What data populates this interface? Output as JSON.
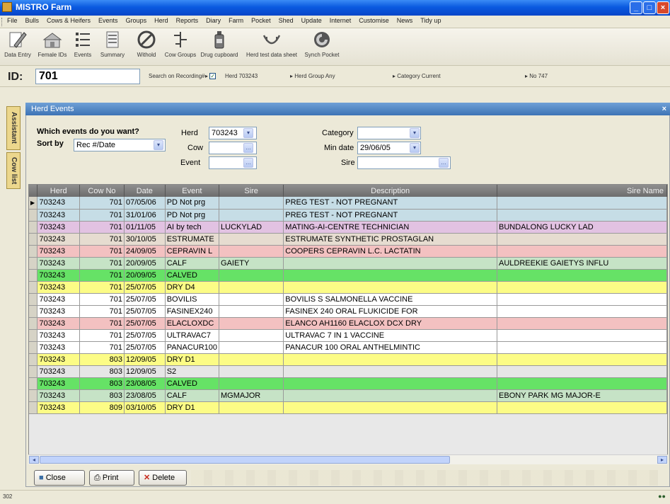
{
  "window": {
    "title": "MISTRO Farm"
  },
  "menu": [
    "File",
    "Bulls",
    "Cows & Heifers",
    "Events",
    "Groups",
    "Herd",
    "Reports",
    "Diary",
    "Farm",
    "Pocket",
    "Shed",
    "Update",
    "Internet",
    "Customise",
    "News",
    "Tidy up"
  ],
  "toolbar": [
    {
      "label": "Data Entry",
      "icon": "pencil-icon"
    },
    {
      "label": "Female IDs",
      "icon": "barn-icon"
    },
    {
      "label": "Events",
      "icon": "list-icon"
    },
    {
      "label": "Summary",
      "icon": "document-icon"
    },
    {
      "label": "Withold",
      "icon": "no-sign-icon"
    },
    {
      "label": "Cow Groups",
      "icon": "cow-groups-icon"
    },
    {
      "label": "Drug cupboard",
      "icon": "bottle-icon"
    },
    {
      "label": "Herd test data sheet",
      "icon": "udder-icon"
    },
    {
      "label": "Synch Pocket",
      "icon": "sync-icon"
    }
  ],
  "idbar": {
    "id_label": "ID:",
    "id_value": "701",
    "search_on": "Search on  Recording#",
    "herd_filter": "Herd  703243",
    "herd_group": "Herd Group  Any",
    "category": "Category  Current",
    "no": "No  747"
  },
  "side_tabs": [
    "Assistant",
    "Cow list"
  ],
  "panel": {
    "title": "Herd Events"
  },
  "criteria": {
    "question": "Which events do you want?",
    "sort_label": "Sort by",
    "sort_value": "Rec #/Date",
    "herd_label": "Herd",
    "herd_value": "703243",
    "cow_label": "Cow",
    "cow_value": "",
    "event_label": "Event",
    "event_value": "",
    "category_label": "Category",
    "category_value": "",
    "min_date_label": "Min date",
    "min_date_value": "29/06/05",
    "sire_label": "Sire",
    "sire_value": ""
  },
  "table": {
    "columns": [
      "Herd",
      "Cow No",
      "Date",
      "Event",
      "Sire",
      "Description",
      "Sire Name"
    ],
    "rows": [
      {
        "herd": "703243",
        "cow": "701",
        "date": "07/05/06",
        "event": "PD Not prg",
        "sire": "",
        "desc": "PREG TEST - NOT PREGNANT",
        "sire_name": "",
        "color": "#c6dde6"
      },
      {
        "herd": "703243",
        "cow": "701",
        "date": "31/01/06",
        "event": "PD Not prg",
        "sire": "",
        "desc": "PREG TEST - NOT PREGNANT",
        "sire_name": "",
        "color": "#c6dde6"
      },
      {
        "herd": "703243",
        "cow": "701",
        "date": "01/11/05",
        "event": "AI by tech",
        "sire": "LUCKYLAD",
        "desc": "MATING-AI-CENTRE TECHNICIAN",
        "sire_name": "BUNDALONG LUCKY LAD",
        "color": "#e2c2e2"
      },
      {
        "herd": "703243",
        "cow": "701",
        "date": "30/10/05",
        "event": "ESTRUMATE",
        "sire": "",
        "desc": "ESTRUMATE SYNTHETIC PROSTAGLAN",
        "sire_name": "",
        "color": "#e6dcd0"
      },
      {
        "herd": "703243",
        "cow": "701",
        "date": "24/09/05",
        "event": "CEPRAVIN L",
        "sire": "",
        "desc": "COOPERS CEPRAVIN L.C. LACTATIN",
        "sire_name": "",
        "color": "#f3c1c1"
      },
      {
        "herd": "703243",
        "cow": "701",
        "date": "20/09/05",
        "event": "CALF",
        "sire": "GAIETY",
        "desc": "",
        "sire_name": "AULDREEKIE GAIETYS INFLU",
        "color": "#c6e3c6"
      },
      {
        "herd": "703243",
        "cow": "701",
        "date": "20/09/05",
        "event": "CALVED",
        "sire": "",
        "desc": "",
        "sire_name": "",
        "color": "#66e266"
      },
      {
        "herd": "703243",
        "cow": "701",
        "date": "25/07/05",
        "event": "DRY D4",
        "sire": "",
        "desc": "",
        "sire_name": "",
        "color": "#fcfc86"
      },
      {
        "herd": "703243",
        "cow": "701",
        "date": "25/07/05",
        "event": "BOVILIS",
        "sire": "",
        "desc": "BOVILIS S SALMONELLA VACCINE",
        "sire_name": "",
        "color": "#ffffff"
      },
      {
        "herd": "703243",
        "cow": "701",
        "date": "25/07/05",
        "event": "FASINEX240",
        "sire": "",
        "desc": "FASINEX 240 ORAL FLUKICIDE FOR",
        "sire_name": "",
        "color": "#ffffff"
      },
      {
        "herd": "703243",
        "cow": "701",
        "date": "25/07/05",
        "event": "ELACLOXDC",
        "sire": "",
        "desc": "ELANCO AH1160 ELACLOX DCX DRY",
        "sire_name": "",
        "color": "#f3c1c1"
      },
      {
        "herd": "703243",
        "cow": "701",
        "date": "25/07/05",
        "event": "ULTRAVAC7",
        "sire": "",
        "desc": "ULTRAVAC 7 IN 1 VACCINE",
        "sire_name": "",
        "color": "#ffffff"
      },
      {
        "herd": "703243",
        "cow": "701",
        "date": "25/07/05",
        "event": "PANACUR100",
        "sire": "",
        "desc": "PANACUR 100 ORAL ANTHELMINTIC",
        "sire_name": "",
        "color": "#ffffff"
      },
      {
        "herd": "703243",
        "cow": "803",
        "date": "12/09/05",
        "event": "DRY D1",
        "sire": "",
        "desc": "",
        "sire_name": "",
        "color": "#fcfc86"
      },
      {
        "herd": "703243",
        "cow": "803",
        "date": "12/09/05",
        "event": "S2",
        "sire": "",
        "desc": "",
        "sire_name": "",
        "color": "#e6e6e6"
      },
      {
        "herd": "703243",
        "cow": "803",
        "date": "23/08/05",
        "event": "CALVED",
        "sire": "",
        "desc": "",
        "sire_name": "",
        "color": "#66e266"
      },
      {
        "herd": "703243",
        "cow": "803",
        "date": "23/08/05",
        "event": "CALF",
        "sire": "MGMAJOR",
        "desc": "",
        "sire_name": "EBONY PARK MG MAJOR-E",
        "color": "#c6e3c6"
      },
      {
        "herd": "703243",
        "cow": "809",
        "date": "03/10/05",
        "event": "DRY D1",
        "sire": "",
        "desc": "",
        "sire_name": "",
        "color": "#fcfc86"
      }
    ]
  },
  "buttons": {
    "close": "Close",
    "print": "Print",
    "delete": "Delete"
  },
  "status": {
    "left": "302"
  }
}
